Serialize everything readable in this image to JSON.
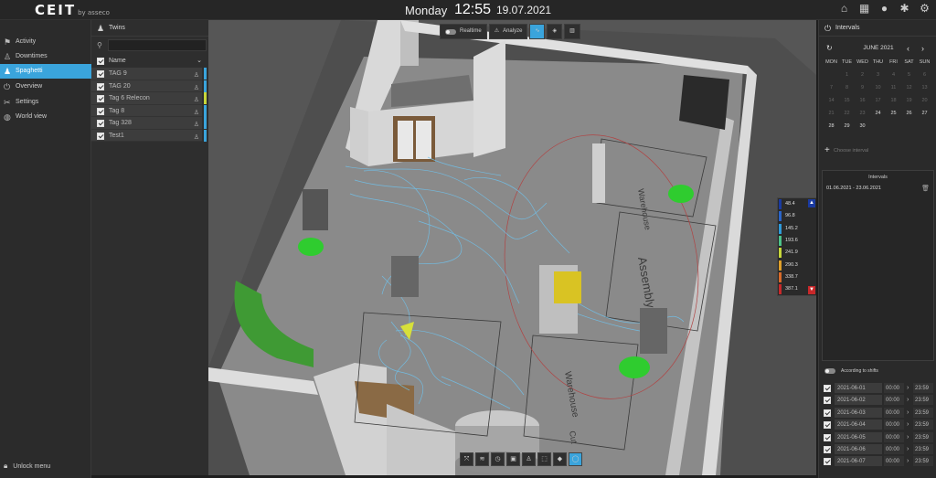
{
  "header": {
    "logo": "CEIT",
    "logo_sub": "by asseco",
    "day": "Monday",
    "time": "12:55",
    "date": "19.07.2021",
    "icons": [
      "home-icon",
      "grid-icon",
      "user-icon",
      "bug-icon",
      "gear-icon"
    ]
  },
  "sidebar": {
    "items": [
      {
        "label": "Activity",
        "icon": "runner-icon"
      },
      {
        "label": "Downtimes",
        "icon": "person-icon"
      },
      {
        "label": "Spaghetti",
        "icon": "people-icon"
      },
      {
        "label": "Overview",
        "icon": "power-icon"
      },
      {
        "label": "Settings",
        "icon": "tools-icon"
      },
      {
        "label": "World view",
        "icon": "globe-icon"
      }
    ],
    "active": "Spaghetti",
    "unlock_label": "Unlock menu"
  },
  "twins": {
    "title": "Twins",
    "search_placeholder": "",
    "column_name": "Name",
    "rows": [
      {
        "name": "TAG 9",
        "color": "#3aa4dc"
      },
      {
        "name": "TAG 20",
        "color": "#3aa4dc"
      },
      {
        "name": "Tag 6 Relecon",
        "color": "#c7d63a"
      },
      {
        "name": "Tag 8",
        "color": "#3aa4dc"
      },
      {
        "name": "Tag 328",
        "color": "#3aa4dc"
      },
      {
        "name": "Test1",
        "color": "#3aa4dc"
      }
    ]
  },
  "view_toolbar": {
    "realtime_label": "Realtime",
    "analyze_label": "Analyze"
  },
  "legend": {
    "values": [
      "48.4",
      "96.8",
      "145.2",
      "193.6",
      "241.9",
      "290.3",
      "338.7",
      "387.1"
    ],
    "colors": [
      "#1a3aa0",
      "#2a64c8",
      "#2f9ad8",
      "#4cc28a",
      "#c7d63a",
      "#e0a02a",
      "#d86a2a",
      "#c8282a"
    ]
  },
  "scene_labels": {
    "warehouse_1": "Warehouse",
    "assembly": "Assembly",
    "warehouse_2": "Warehouse",
    "cut": "Cut"
  },
  "intervals_panel": {
    "title": "Intervals",
    "month_label": "JUNE 2021",
    "weekdays": [
      "MON",
      "TUE",
      "WED",
      "THU",
      "FRI",
      "SAT",
      "SUN"
    ],
    "calendar_cells": [
      "",
      "1",
      "2",
      "3",
      "4",
      "5",
      "6",
      "7",
      "8",
      "9",
      "10",
      "11",
      "12",
      "13",
      "14",
      "15",
      "16",
      "17",
      "18",
      "19",
      "20",
      "21",
      "22",
      "23",
      "24",
      "25",
      "26",
      "27",
      "28",
      "29",
      "30",
      "",
      "",
      "",
      ""
    ],
    "choose_placeholder": "Choose interval",
    "intervals_title": "Intervals",
    "interval_entry": "01.06.2021 - 23.06.2021",
    "shifts_label": "According to shifts",
    "shift_rows": [
      {
        "date": "2021-06-01",
        "start": "00:00",
        "end": "23:59"
      },
      {
        "date": "2021-06-02",
        "start": "00:00",
        "end": "23:59"
      },
      {
        "date": "2021-06-03",
        "start": "00:00",
        "end": "23:59"
      },
      {
        "date": "2021-06-04",
        "start": "00:00",
        "end": "23:59"
      },
      {
        "date": "2021-06-05",
        "start": "00:00",
        "end": "23:59"
      },
      {
        "date": "2021-06-06",
        "start": "00:00",
        "end": "23:59"
      },
      {
        "date": "2021-06-07",
        "start": "00:00",
        "end": "23:59"
      }
    ]
  }
}
